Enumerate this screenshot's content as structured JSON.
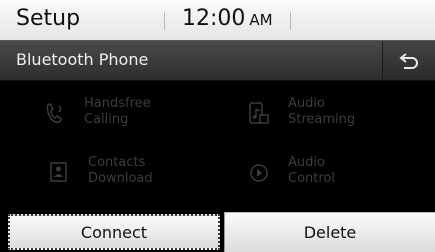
{
  "status_bar": {
    "title": "Setup",
    "time": "12:00",
    "ampm": "AM"
  },
  "header": {
    "title": "Bluetooth Phone",
    "back_icon": "back-arrow-icon"
  },
  "menu": {
    "items": [
      {
        "line1": "Handsfree",
        "line2": "Calling",
        "icon": "handsfree-phone-icon",
        "enabled": false
      },
      {
        "line1": "Audio",
        "line2": "Streaming",
        "icon": "audio-streaming-icon",
        "enabled": false
      },
      {
        "line1": "Contacts",
        "line2": "Download",
        "icon": "contacts-icon",
        "enabled": false
      },
      {
        "line1": "Audio",
        "line2": "Control",
        "icon": "audio-control-icon",
        "enabled": false
      }
    ]
  },
  "buttons": {
    "connect_label": "Connect",
    "delete_label": "Delete"
  },
  "colors": {
    "bar_light": "#f2f2f2",
    "header_dark": "#3a3a3a",
    "disabled_text": "#3c3c3c",
    "background": "#000000"
  }
}
